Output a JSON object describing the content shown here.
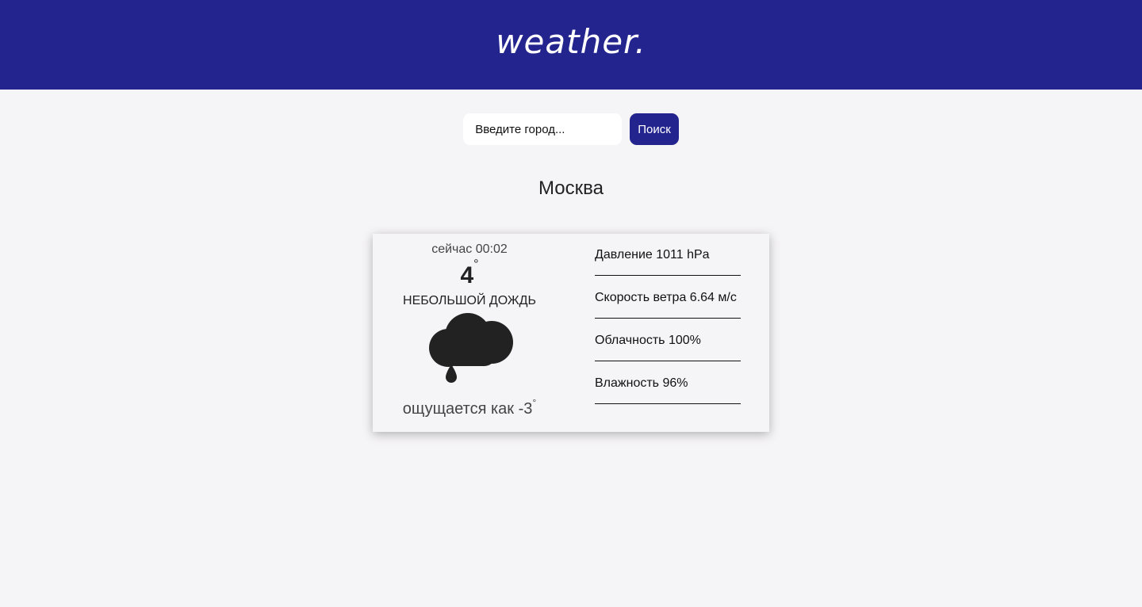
{
  "header": {
    "logo": "weather."
  },
  "search": {
    "placeholder": "Введите город...",
    "button_label": "Поиск"
  },
  "city": "Москва",
  "current": {
    "time": "сейчас 00:02",
    "temperature": "4",
    "degree_symbol": "°",
    "condition": "НЕБОЛЬШОЙ ДОЖДЬ",
    "icon": "cloud-rain-icon",
    "feels_like": "ощущается как -3"
  },
  "details": [
    {
      "label": "Давление 1011 hPa"
    },
    {
      "label": "Скорость ветра 6.64 м/с"
    },
    {
      "label": "Облачность 100%"
    },
    {
      "label": "Влажность 96%"
    }
  ],
  "colors": {
    "brand": "#24248f",
    "background": "#f5f4f7",
    "icon": "#222222"
  }
}
